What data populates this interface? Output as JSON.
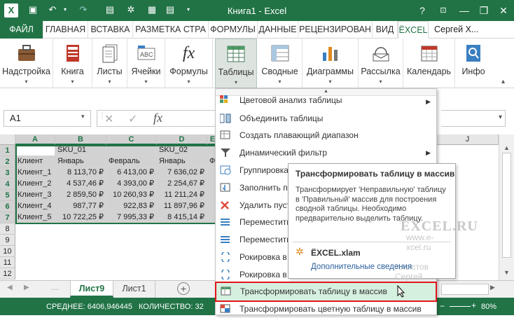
{
  "titlebar": {
    "title": "Книга1 - Excel",
    "help": "?",
    "minimize": "—",
    "restore": "❐",
    "close": "✕",
    "ribbon_opts": "🗖"
  },
  "tabs": [
    "ФАЙЛ",
    "ГЛАВНАЯ",
    "ВСТАВКА",
    "РАЗМЕТКА СТРА",
    "ФОРМУЛЫ",
    "ДАННЫЕ",
    "РЕЦЕНЗИРОВАН",
    "ВИД",
    "ЁXCEL"
  ],
  "user": "Сергей Х...",
  "ribbon": [
    {
      "label": "Надстройка",
      "icon": "briefcase-icon"
    },
    {
      "label": "Книга",
      "icon": "book-icon"
    },
    {
      "label": "Листы",
      "icon": "sheets-icon"
    },
    {
      "label": "Ячейки",
      "icon": "cells-icon"
    },
    {
      "label": "Формулы",
      "icon": "fx-icon"
    },
    {
      "label": "Таблицы",
      "icon": "table-icon"
    },
    {
      "label": "Сводные",
      "icon": "pivot-icon"
    },
    {
      "label": "Диаграммы",
      "icon": "chart-icon"
    },
    {
      "label": "Рассылка",
      "icon": "mail-icon"
    },
    {
      "label": "Календарь",
      "icon": "calendar-icon"
    },
    {
      "label": "Инфо",
      "icon": "info-icon"
    }
  ],
  "formula": {
    "namebox": "A1",
    "cancel": "✕",
    "enter": "✓",
    "fx": "fx"
  },
  "columns": [
    "A",
    "B",
    "C",
    "D",
    "E",
    "J"
  ],
  "rows": [
    "1",
    "2",
    "3",
    "4",
    "5",
    "6",
    "7",
    "8",
    "9",
    "10",
    "11",
    "12"
  ],
  "cells": {
    "r1": [
      "",
      "SKU_01",
      "",
      "SKU_02",
      "",
      ""
    ],
    "r2": [
      "Клиент",
      "Январь",
      "Февраль",
      "Январь",
      "Фе"
    ],
    "r3": [
      "Клиент_1",
      "8 113,70 ₽",
      "6 413,00 ₽",
      "7 636,02 ₽",
      ""
    ],
    "r4": [
      "Клиент_2",
      "4 537,46 ₽",
      "4 393,00 ₽",
      "2 254,67 ₽",
      ""
    ],
    "r5": [
      "Клиент_3",
      "2 859,50 ₽",
      "10 260,93 ₽",
      "11 211,24 ₽",
      ""
    ],
    "r6": [
      "Клиент_4",
      "987,77 ₽",
      "922,83 ₽",
      "11 897,96 ₽",
      ""
    ],
    "r7": [
      "Клиент_5",
      "10 722,25 ₽",
      "7 995,33 ₽",
      "8 415,14 ₽",
      ""
    ]
  },
  "sheets": [
    "Лист9",
    "Лист1"
  ],
  "status": {
    "avg": "СРЕДНЕЕ: 6406,946445",
    "count": "КОЛИЧЕСТВО: 32",
    "zoom": "80%"
  },
  "menu": [
    {
      "label": "Цветовой анализ таблицы",
      "sub": true
    },
    {
      "label": "Объединить таблицы"
    },
    {
      "label": "Создать плавающий диапазон"
    },
    {
      "label": "Динамический фильтр",
      "sub": true
    },
    {
      "label": "Группировка"
    },
    {
      "label": "Заполнить п"
    },
    {
      "label": "Удалить пуст"
    },
    {
      "label": "Переместить"
    },
    {
      "label": "Переместить"
    },
    {
      "label": "Рокировка в"
    },
    {
      "label": "Рокировка в"
    },
    {
      "label": "Трансформировать таблицу в массив"
    },
    {
      "label": "Трансформировать цветную таблицу в массив"
    }
  ],
  "tooltip": {
    "title": "Трансформировать таблицу в массив",
    "body": "Трансформирует 'Неправильную' таблицу в 'Правильный' массив для построения сводной таблицы. Необходимо предварительно выделить таблицу.",
    "addin": "ЁXCEL.xlam",
    "more": "Дополнительные сведения",
    "wm1": "EXCEL.RU",
    "wm2": "www.e-xcel.ru",
    "wm3": "Хлыстов Сергей"
  }
}
